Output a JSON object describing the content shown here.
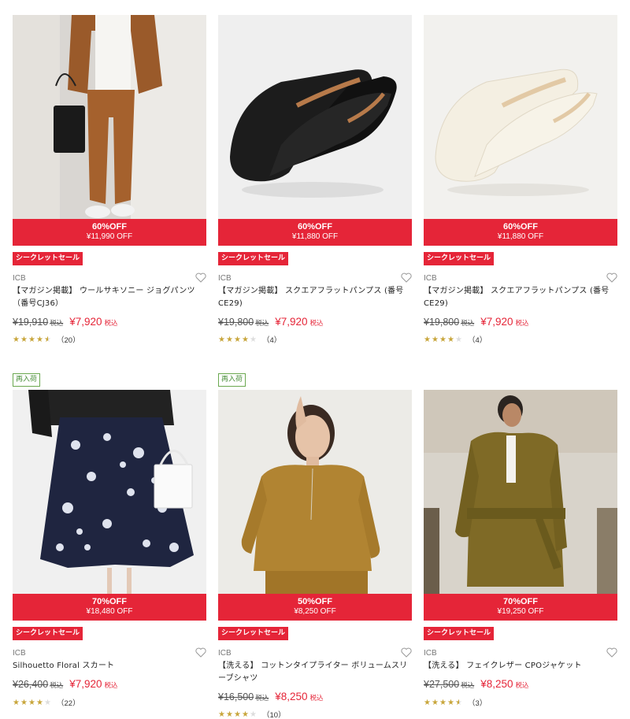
{
  "products": [
    {
      "brand": "ICB",
      "name": "【マガジン掲載】 ウールサキソニー ジョグパンツ（番号CJ36）",
      "discount_pct": "60%OFF",
      "discount_amount": "¥11,990 OFF",
      "secret_label": "シークレットセール",
      "restock_label": null,
      "original_price": "¥19,910",
      "original_tax": "税込",
      "sale_price": "¥7,920",
      "sale_tax": "税込",
      "rating": 4.5,
      "review_count": "（20）",
      "image": "model-brown-pants-photo"
    },
    {
      "brand": "ICB",
      "name": "【マガジン掲載】 スクエアフラットパンプス (番号CE29)",
      "discount_pct": "60%OFF",
      "discount_amount": "¥11,880 OFF",
      "secret_label": "シークレットセール",
      "restock_label": null,
      "original_price": "¥19,800",
      "original_tax": "税込",
      "sale_price": "¥7,920",
      "sale_tax": "税込",
      "rating": 4,
      "review_count": "（4）",
      "image": "black-flat-pumps-photo"
    },
    {
      "brand": "ICB",
      "name": "【マガジン掲載】 スクエアフラットパンプス (番号CE29)",
      "discount_pct": "60%OFF",
      "discount_amount": "¥11,880 OFF",
      "secret_label": "シークレットセール",
      "restock_label": null,
      "original_price": "¥19,800",
      "original_tax": "税込",
      "sale_price": "¥7,920",
      "sale_tax": "税込",
      "rating": 4,
      "review_count": "（4）",
      "image": "ivory-flat-pumps-photo"
    },
    {
      "brand": "ICB",
      "name": "Silhouetto Floral スカート",
      "discount_pct": "70%OFF",
      "discount_amount": "¥18,480 OFF",
      "secret_label": "シークレットセール",
      "restock_label": "再入荷",
      "original_price": "¥26,400",
      "original_tax": "税込",
      "sale_price": "¥7,920",
      "sale_tax": "税込",
      "rating": 4,
      "review_count": "（22）",
      "image": "floral-skirt-photo"
    },
    {
      "brand": "ICB",
      "name": "【洗える】 コットンタイプライター ボリュームスリーブシャツ",
      "discount_pct": "50%OFF",
      "discount_amount": "¥8,250 OFF",
      "secret_label": "シークレットセール",
      "restock_label": "再入荷",
      "original_price": "¥16,500",
      "original_tax": "税込",
      "sale_price": "¥8,250",
      "sale_tax": "税込",
      "rating": 4,
      "review_count": "（10）",
      "image": "mustard-blouse-photo"
    },
    {
      "brand": "ICB",
      "name": "【洗える】 フェイクレザー CPOジャケット",
      "discount_pct": "70%OFF",
      "discount_amount": "¥19,250 OFF",
      "secret_label": "シークレットセール",
      "restock_label": null,
      "original_price": "¥27,500",
      "original_tax": "税込",
      "sale_price": "¥8,250",
      "sale_tax": "税込",
      "rating": 4.5,
      "review_count": "（3）",
      "image": "olive-leather-jacket-photo"
    }
  ],
  "colors": {
    "sale_red": "#e52538",
    "restock_green": "#4a8f3a",
    "star_gold": "#c8a63c"
  }
}
